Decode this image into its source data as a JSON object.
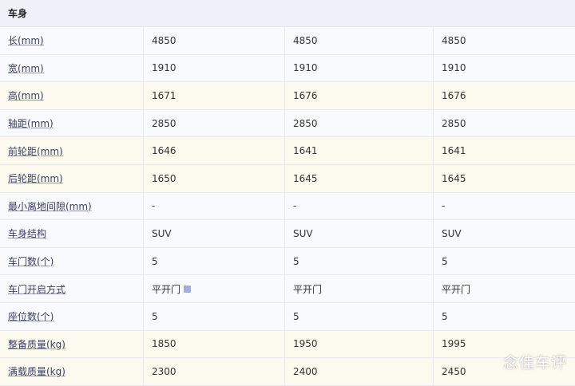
{
  "section_title": "车身",
  "rows": [
    {
      "label": "长(mm)",
      "values": [
        "4850",
        "4850",
        "4850"
      ],
      "diff": false
    },
    {
      "label": "宽(mm)",
      "values": [
        "1910",
        "1910",
        "1910"
      ],
      "diff": false
    },
    {
      "label": "高(mm)",
      "values": [
        "1671",
        "1676",
        "1676"
      ],
      "diff": true
    },
    {
      "label": "轴距(mm)",
      "values": [
        "2850",
        "2850",
        "2850"
      ],
      "diff": false
    },
    {
      "label": "前轮距(mm)",
      "values": [
        "1646",
        "1641",
        "1641"
      ],
      "diff": true
    },
    {
      "label": "后轮距(mm)",
      "values": [
        "1650",
        "1645",
        "1645"
      ],
      "diff": true
    },
    {
      "label": "最小离地间隙(mm)",
      "values": [
        "-",
        "-",
        "-"
      ],
      "diff": false
    },
    {
      "label": "车身结构",
      "values": [
        "SUV",
        "SUV",
        "SUV"
      ],
      "diff": false
    },
    {
      "label": "车门数(个)",
      "values": [
        "5",
        "5",
        "5"
      ],
      "diff": false
    },
    {
      "label": "车门开启方式",
      "values": [
        "平开门",
        "平开门",
        "平开门"
      ],
      "diff": false
    },
    {
      "label": "座位数(个)",
      "values": [
        "5",
        "5",
        "5"
      ],
      "diff": false
    },
    {
      "label": "整备质量(kg)",
      "values": [
        "1850",
        "1950",
        "1995"
      ],
      "diff": true
    },
    {
      "label": "满载质量(kg)",
      "values": [
        "2300",
        "2400",
        "2450"
      ],
      "diff": true
    }
  ],
  "watermark": "念佳车评"
}
